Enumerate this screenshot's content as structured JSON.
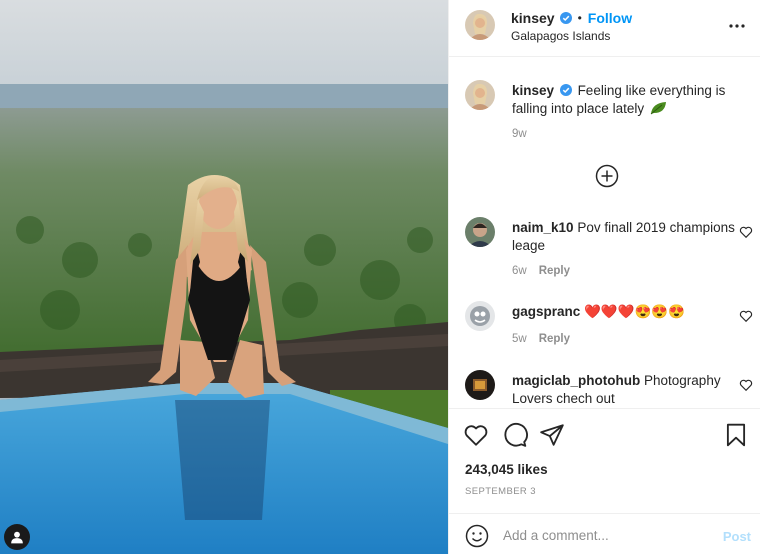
{
  "post": {
    "author": "kinsey",
    "verified": true,
    "follow_label": "Follow",
    "separator": "•",
    "location": "Galapagos Islands",
    "caption": "Feeling like everything is falling into place lately",
    "caption_emoji": "leaf",
    "caption_age": "9w"
  },
  "comments": [
    {
      "user": "naim_k10",
      "text": "Pov finall 2019 champions leage",
      "age": "6w",
      "reply_label": "Reply"
    },
    {
      "user": "gagspranc",
      "text": "❤️❤️❤️😍😍😍",
      "age": "5w",
      "reply_label": "Reply"
    },
    {
      "user": "magiclab_photohub",
      "text": "Photography Lovers chech out"
    }
  ],
  "engagement": {
    "likes": "243,045 likes",
    "date": "SEPTEMBER 3"
  },
  "comment_box": {
    "placeholder": "Add a comment...",
    "post_label": "Post"
  },
  "icons": {
    "more": "more-horizontal-icon",
    "load_more": "plus-circle-icon",
    "like": "heart-outline-icon",
    "comment": "speech-bubble-icon",
    "share": "paper-plane-icon",
    "save": "bookmark-icon",
    "emoji": "smiley-icon",
    "tagged": "user-tag-icon"
  },
  "colors": {
    "accent": "#0095f6",
    "verified": "#3897f0",
    "muted_text": "#8e8e8e",
    "post_disabled": "#b2dffc",
    "heart_emoji": "#e0245e"
  }
}
